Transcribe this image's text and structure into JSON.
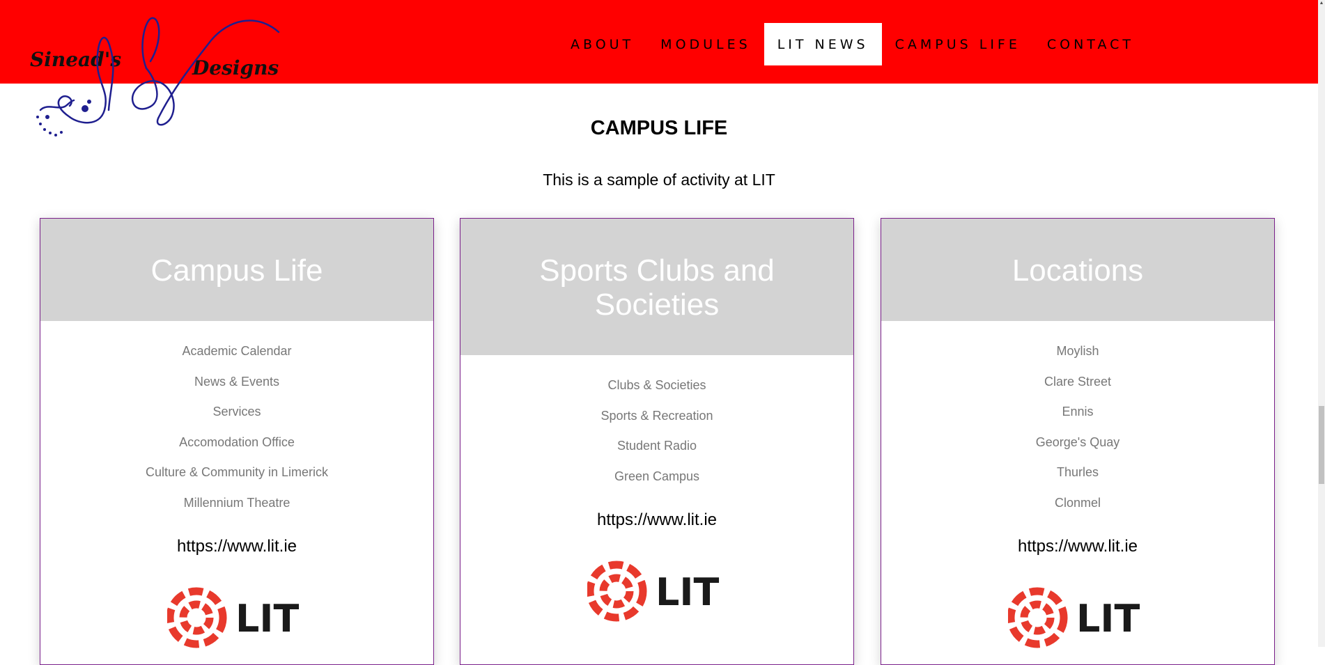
{
  "brand": {
    "left_text": "Sinead's",
    "right_text": "Designs",
    "logo_color": "#1f1f8f"
  },
  "nav": {
    "items": [
      {
        "label": "ABOUT"
      },
      {
        "label": "MODULES"
      },
      {
        "label": "LIT NEWS",
        "active": true
      },
      {
        "label": "CAMPUS LIFE"
      },
      {
        "label": "CONTACT"
      }
    ]
  },
  "page": {
    "title": "CAMPUS LIFE",
    "subtitle": "This is a sample of activity at LIT"
  },
  "cards": [
    {
      "title": "Campus Life",
      "links": [
        "Academic Calendar",
        "News & Events",
        "Services",
        "Accomodation Office",
        "Culture & Community in Limerick",
        "Millennium Theatre"
      ],
      "url": "https://www.lit.ie",
      "logo_text": "LIT"
    },
    {
      "title": "Sports Clubs and Societies",
      "links": [
        "Clubs & Societies",
        "Sports & Recreation",
        "Student Radio",
        "Green Campus"
      ],
      "url": "https://www.lit.ie",
      "logo_text": "LIT"
    },
    {
      "title": "Locations",
      "links": [
        "Moylish",
        "Clare Street",
        "Ennis",
        "George's Quay",
        "Thurles",
        "Clonmel"
      ],
      "url": "https://www.lit.ie",
      "logo_text": "LIT"
    }
  ],
  "colors": {
    "nav_background": "#ff0000",
    "card_header": "#d3d3d3",
    "card_border": "#7a1f8a",
    "link_text": "#777777",
    "lit_logo_red": "#e8392c",
    "lit_logo_text": "#1a1a1a"
  }
}
